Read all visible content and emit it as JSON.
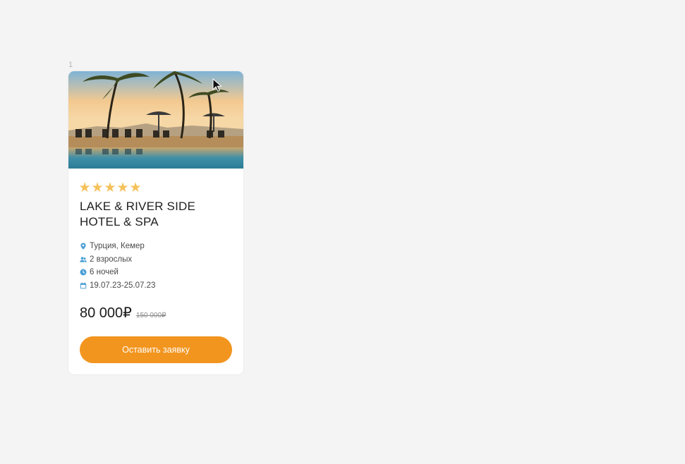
{
  "page_index": "1",
  "hotel": {
    "stars": [
      "★",
      "★",
      "★",
      "★",
      "★"
    ],
    "name": "LAKE & RIVER SIDE HOTEL & SPA",
    "location": "Турция, Кемер",
    "guests": "2 взрослых",
    "nights": "6 ночей",
    "dates": "19.07.23-25.07.23",
    "price": "80 000₽",
    "old_price": "150 000₽"
  },
  "cta": {
    "label": "Оставить заявку"
  },
  "icons": {
    "location": "map-pin-icon",
    "guests": "people-icon",
    "nights": "clock-icon",
    "dates": "calendar-icon"
  },
  "colors": {
    "accent": "#f2951f",
    "star": "#f5c15a",
    "info_icon": "#4a9fd6"
  }
}
